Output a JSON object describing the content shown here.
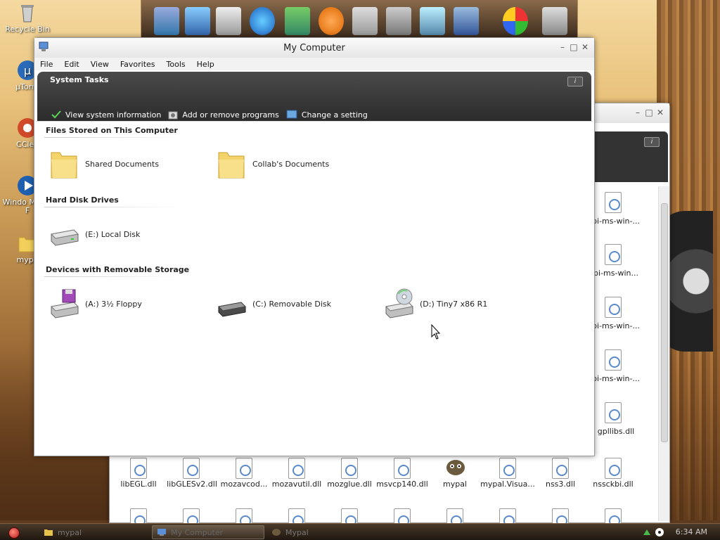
{
  "desktop": {
    "icons": [
      {
        "label": "Recycle Bin",
        "icon": "recycle-bin-icon"
      },
      {
        "label": "µTorre",
        "icon": "utorrent-icon"
      },
      {
        "label": "CClea",
        "icon": "ccleaner-icon"
      },
      {
        "label": "Windo Media F",
        "icon": "windows-media-player-icon"
      },
      {
        "label": "mypa",
        "icon": "folder-icon"
      }
    ]
  },
  "mycomputer": {
    "title": "My Computer",
    "menu": [
      "File",
      "Edit",
      "View",
      "Favorites",
      "Tools",
      "Help"
    ],
    "system_tasks": {
      "title": "System Tasks",
      "info_label": "i",
      "links": [
        "View system information",
        "Add or remove programs",
        "Change a setting"
      ]
    },
    "groups": [
      {
        "title": "Files Stored on This Computer",
        "items": [
          "Shared Documents",
          "Collab's Documents"
        ]
      },
      {
        "title": "Hard Disk Drives",
        "items": [
          "(E:) Local Disk"
        ]
      },
      {
        "title": "Devices with Removable Storage",
        "items": [
          "(A:) 3½ Floppy",
          "(C:) Removable Disk",
          "(D:) Tiny7 x86 R1"
        ]
      }
    ]
  },
  "bgwindow": {
    "info_label": "i",
    "right_files": [
      "pi-ms-win-...",
      "pi-ms-win...",
      "pi-ms-win-...",
      "pi-ms-win-...",
      "gpllibs.dll"
    ],
    "bottom_files": [
      "libEGL.dll",
      "libGLESv2.dll",
      "mozavcod...",
      "mozavutil.dll",
      "mozglue.dll",
      "msvcp140.dll",
      "mypal",
      "mypal.Visua...",
      "nss3.dll",
      "nssckbi.dll"
    ]
  },
  "taskbar": {
    "buttons": [
      "mypal",
      "My Computer",
      "Mypal"
    ],
    "clock": "6:34 AM"
  }
}
